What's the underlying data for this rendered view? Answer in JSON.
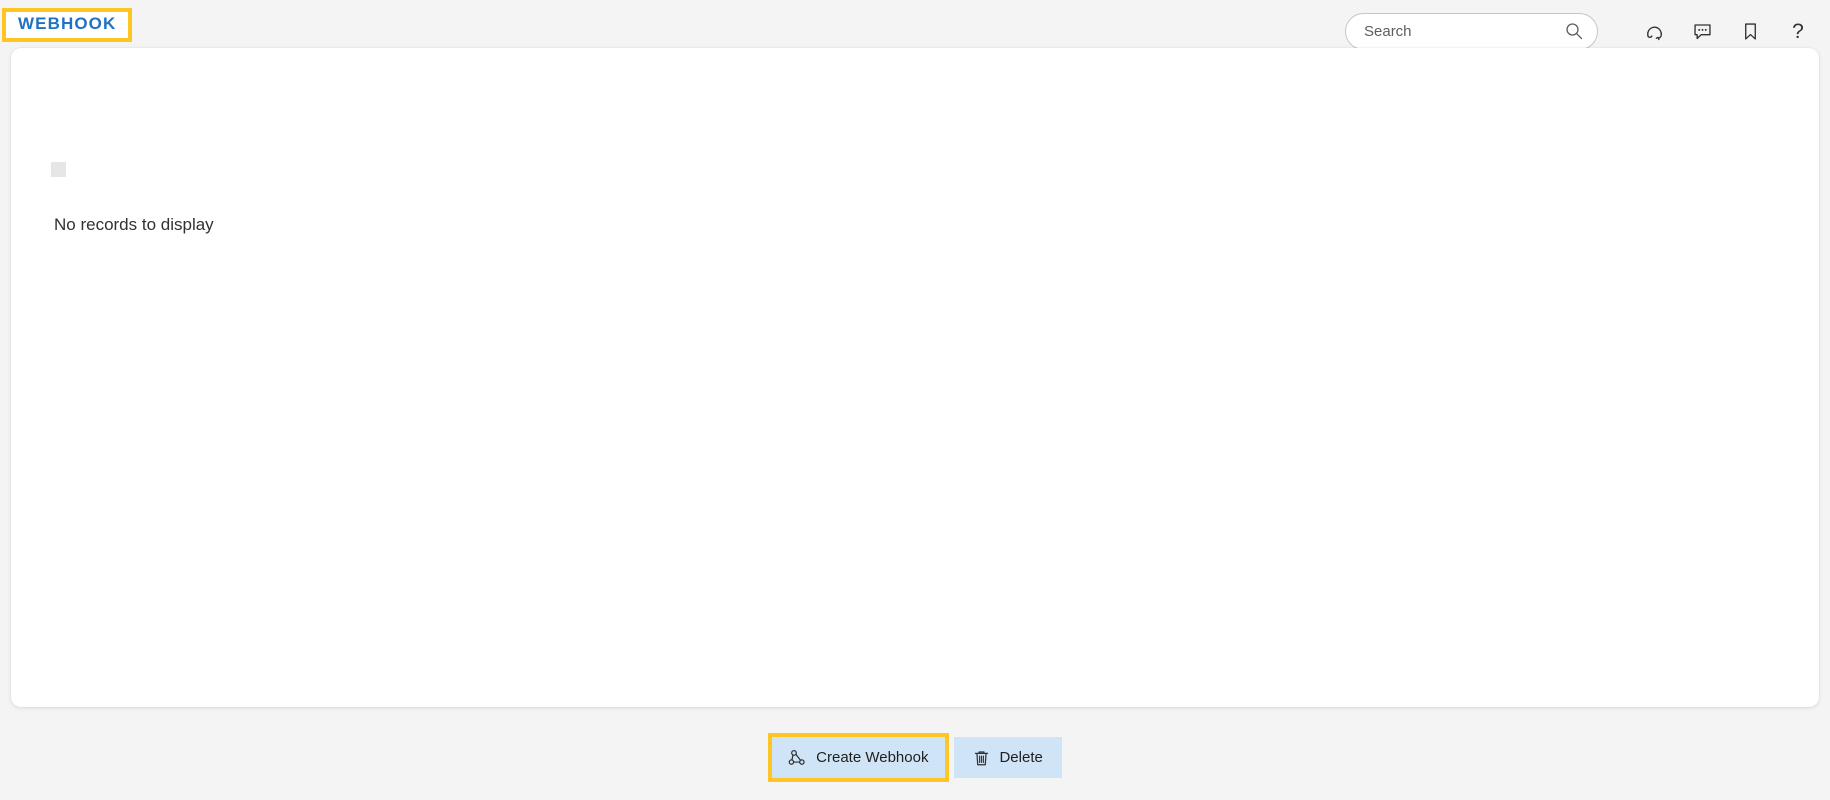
{
  "header": {
    "title": "WEBHOOK",
    "title_color": "#1f72c4",
    "highlight_color": "#ffc524",
    "search": {
      "placeholder": "Search",
      "value": "",
      "icon": "search-icon"
    },
    "icons": [
      {
        "name": "headset-support-icon",
        "glyph": "headset"
      },
      {
        "name": "chat-bubble-icon",
        "glyph": "chat"
      },
      {
        "name": "bookmark-icon",
        "glyph": "bookmark"
      },
      {
        "name": "help-question-icon",
        "glyph": "?"
      }
    ]
  },
  "main": {
    "empty_message": "No records to display",
    "placeholder_swatch_color": "#e6e6e6",
    "card_background": "#ffffff"
  },
  "footer": {
    "buttons": [
      {
        "label": "Create Webhook",
        "icon": "webhook-icon",
        "highlighted": true,
        "background": "#cfe4f7"
      },
      {
        "label": "Delete",
        "icon": "trash-icon",
        "highlighted": false,
        "background": "#cfe4f7"
      }
    ]
  },
  "page": {
    "background": "#f4f4f4"
  }
}
